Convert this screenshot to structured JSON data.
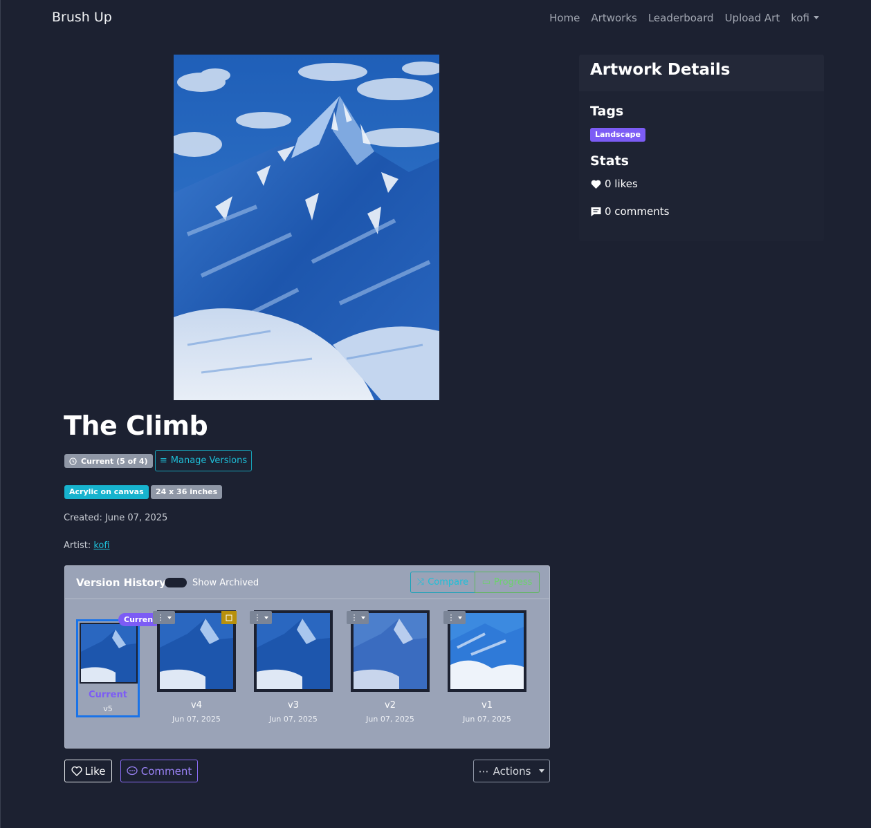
{
  "nav": {
    "brand": "Brush Up",
    "links": [
      "Home",
      "Artworks",
      "Leaderboard",
      "Upload Art"
    ],
    "user": "kofi"
  },
  "artwork": {
    "title": "The Climb",
    "version_badge": "Current (5 of 4)",
    "manage_versions": "Manage Versions",
    "medium": "Acrylic on canvas",
    "size": "24 x 36 inches",
    "created": "Created: June 07, 2025",
    "artist_label": "Artist: ",
    "artist_name": "kofi"
  },
  "version_history": {
    "title": "Version History",
    "show_archived": "Show Archived",
    "compare": "Compare",
    "progress": "Progress",
    "current_pill": "Current",
    "current_label": "Current",
    "current_sub": "v5",
    "versions": [
      {
        "label": "v4",
        "date": "Jun 07, 2025"
      },
      {
        "label": "v3",
        "date": "Jun 07, 2025"
      },
      {
        "label": "v2",
        "date": "Jun 07, 2025"
      },
      {
        "label": "v1",
        "date": "Jun 07, 2025"
      }
    ]
  },
  "actions": {
    "like": "Like",
    "comment": "Comment",
    "more": "Actions"
  },
  "sidebar": {
    "title": "Artwork Details",
    "tags_heading": "Tags",
    "tags": [
      "Landscape"
    ],
    "stats_heading": "Stats",
    "likes": "0 likes",
    "comments": "0 comments"
  },
  "colors": {
    "background": "#1c2131",
    "accent_purple": "#7c5cf5",
    "info_cyan": "#17b3ce",
    "success_green": "#5cb85c"
  }
}
